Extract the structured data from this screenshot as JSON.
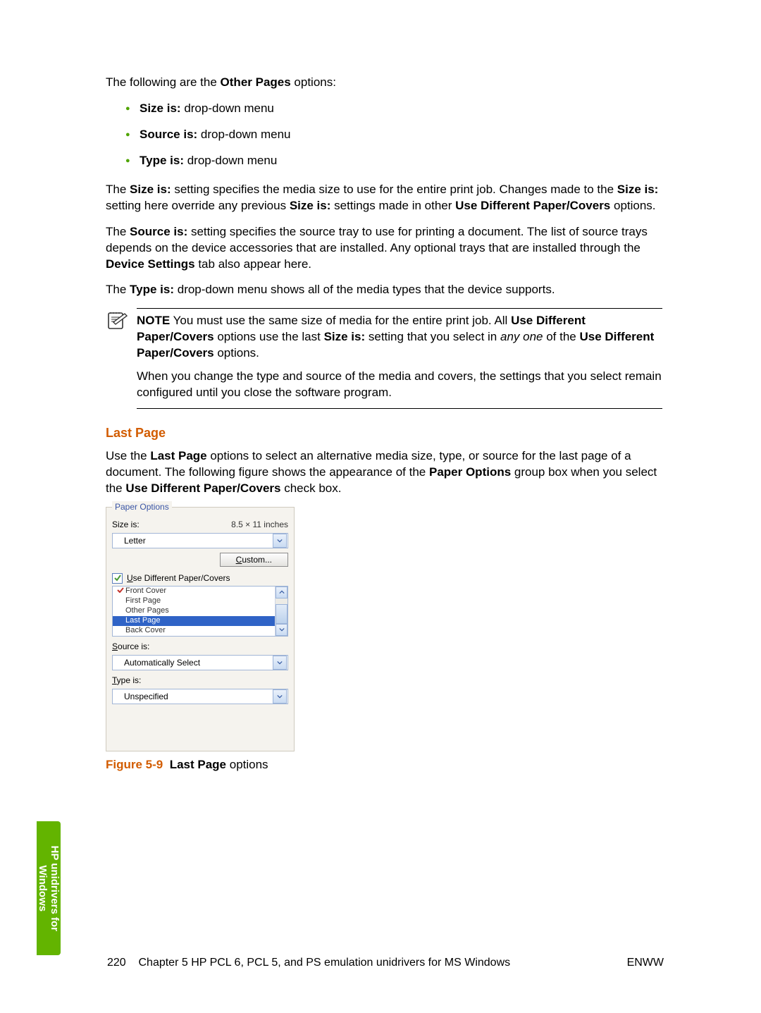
{
  "intro": {
    "lead_prefix": "The following are the ",
    "lead_bold": "Other Pages",
    "lead_suffix": " options:"
  },
  "bullets": [
    {
      "bold": "Size is:",
      "rest": " drop-down menu"
    },
    {
      "bold": "Source is:",
      "rest": " drop-down menu"
    },
    {
      "bold": "Type is:",
      "rest": " drop-down menu"
    }
  ],
  "para_size": {
    "p1": "The ",
    "b1": "Size is:",
    "p2": " setting specifies the media size to use for the entire print job. Changes made to the ",
    "b2": "Size is:",
    "p3": " setting here override any previous ",
    "b3": "Size is:",
    "p4": " settings made in other ",
    "b4": "Use Different Paper/Covers",
    "p5": " options."
  },
  "para_source": {
    "p1": "The ",
    "b1": "Source is:",
    "p2": " setting specifies the source tray to use for printing a document. The list of source trays depends on the device accessories that are installed. Any optional trays that are installed through the ",
    "b2": "Device Settings",
    "p3": " tab also appear here."
  },
  "para_type": {
    "p1": "The ",
    "b1": "Type is:",
    "p2": " drop-down menu shows all of the media types that the device supports."
  },
  "note": {
    "label": "NOTE",
    "p1": "   You must use the same size of media for the entire print job. All ",
    "b1": "Use Different Paper/Covers",
    "p2": " options use the last ",
    "b2": "Size is:",
    "p3": " setting that you select in ",
    "i1": "any one",
    "p4": " of the ",
    "b3": "Use Different Paper/Covers",
    "p5": " options.",
    "p6": "When you change the type and source of the media and covers, the settings that you select remain configured until you close the software program."
  },
  "section_heading": "Last Page",
  "lastpage_para": {
    "p1": "Use the ",
    "b1": "Last Page",
    "p2": " options to select an alternative media size, type, or source for the last page of a document. The following figure shows the appearance of the ",
    "b2": "Paper Options",
    "p3": " group box when you select the ",
    "b3": "Use Different Paper/Covers",
    "p4": " check box."
  },
  "paper_options": {
    "legend": "Paper Options",
    "size_label": "Size is:",
    "size_dims": "8.5 × 11 inches",
    "size_value": "Letter",
    "custom_btn_u": "C",
    "custom_btn_rest": "ustom...",
    "chk_u": "U",
    "chk_rest": "se Different Paper/Covers",
    "list": {
      "front": "Front Cover",
      "first": "First Page",
      "other": "Other Pages",
      "last": "Last Page",
      "back": "Back Cover"
    },
    "source_u": "S",
    "source_rest": "ource is:",
    "source_value": "Automatically Select",
    "type_u": "T",
    "type_rest": "ype is:",
    "type_value": "Unspecified"
  },
  "figure": {
    "num": "Figure 5-9",
    "bold": "Last Page",
    "rest": " options"
  },
  "side_tab": {
    "line1": "HP unidrivers for",
    "line2": "Windows"
  },
  "footer": {
    "page_no": "220",
    "chapter": "Chapter 5   HP PCL 6, PCL 5, and PS emulation unidrivers for MS Windows",
    "right": "ENWW"
  }
}
